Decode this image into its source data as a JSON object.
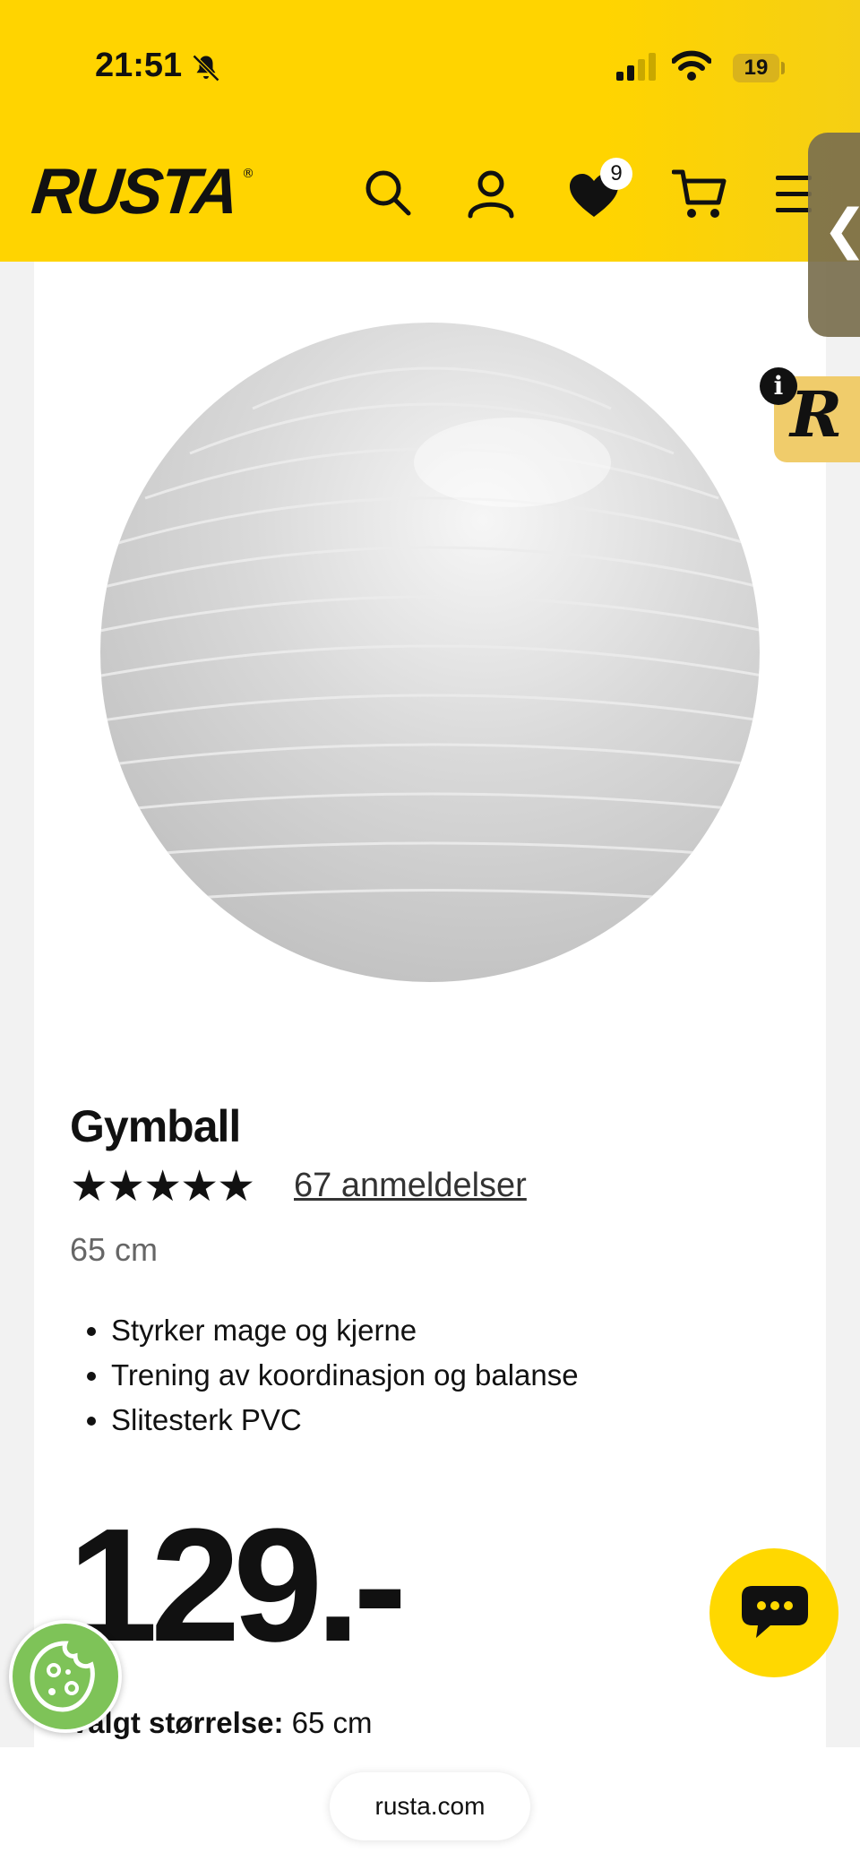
{
  "status_bar": {
    "time": "21:51",
    "battery": "19",
    "icons": [
      "bell-slash-icon",
      "signal-icon",
      "wifi-icon",
      "battery-icon"
    ]
  },
  "header": {
    "logo": "RUSTA",
    "logo_mark": "®",
    "wishlist_count": "9",
    "icons": [
      "search-icon",
      "user-icon",
      "heart-icon",
      "cart-icon",
      "menu-icon"
    ],
    "accent_color": "#ffd400"
  },
  "side_widgets": {
    "handle_icon": "chevron-left-icon",
    "handle_glyph": "❮",
    "badge_letter": "R",
    "info_glyph": "i"
  },
  "product": {
    "title": "Gymball",
    "rating": 5,
    "stars": "★★★★★",
    "reviews": "67 anmeldelser",
    "size": "65 cm",
    "features": [
      "Styrker mage og kjerne",
      "Trening av koordinasjon og balanse",
      "Slitesterk PVC"
    ],
    "price": "129.-",
    "selected_size_label": "Valgt størrelse:",
    "selected_size_value": "65 cm"
  },
  "floating": {
    "chat_icon": "chat-bubble-icon",
    "cookie_icon": "cookie-icon"
  },
  "browser": {
    "url": "rusta.com"
  }
}
